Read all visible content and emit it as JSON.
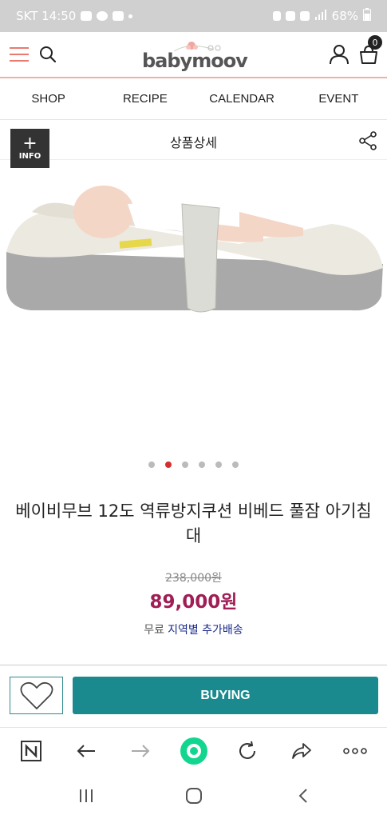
{
  "status_bar": {
    "carrier_time": "SKT 14:50",
    "battery": "68%"
  },
  "header": {
    "logo": "babymoov",
    "cart_count": "0"
  },
  "nav": {
    "items": [
      {
        "label": "SHOP"
      },
      {
        "label": "RECIPE"
      },
      {
        "label": "CALENDAR"
      },
      {
        "label": "EVENT"
      }
    ]
  },
  "subheader": {
    "title": "상품상세",
    "info_label": "INFO",
    "info_plus": "+"
  },
  "carousel": {
    "count": 6,
    "active_index": 1
  },
  "product": {
    "title": "베이비무브 12도 역류방지쿠션 비베드 풀잠 아기침대",
    "original_price": "238,000원",
    "sale_price": "89,000원",
    "shipping_free": "무료",
    "shipping_region": "지역별 추가배송"
  },
  "actions": {
    "buy_label": "BUYING"
  },
  "colors": {
    "accent": "#1a8a8f",
    "price": "#a01e55",
    "header_line": "#e8b3ae",
    "hamburger": "#e87a70"
  }
}
